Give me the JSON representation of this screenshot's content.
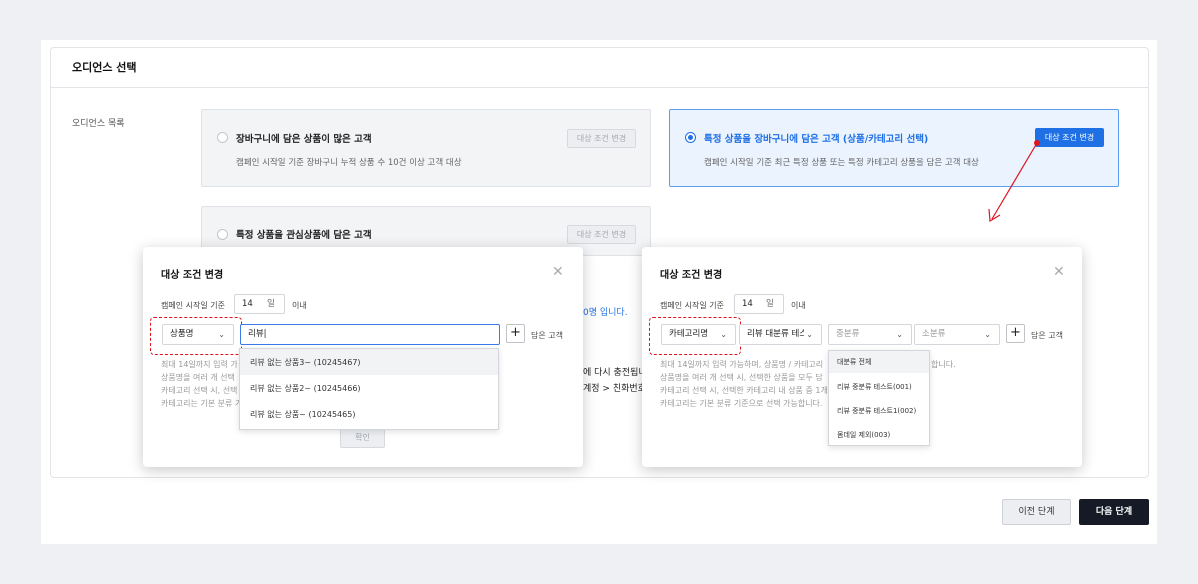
{
  "section": {
    "title": "오디언스 선택",
    "list_label": "오디언스 목록"
  },
  "options": [
    {
      "title": "장바구니에 담은 상품이 많은 고객",
      "desc": "캠페인 시작일 기준 장바구니 누적 상품 수 10건 이상 고객 대상",
      "button": "대상 조건 변경",
      "selected": false
    },
    {
      "title": "특정 상품을 장바구니에 담은 고객 (상품/카테고리 선택)",
      "desc": "캠페인 시작일 기준 최근 특정 상품 또는 특정 카테고리 상품을 담은 고객 대상",
      "button": "대상 조건 변경",
      "selected": true
    },
    {
      "title": "특정 상품을 관심상품에 담은 고객",
      "button": "대상 조건 변경",
      "selected": false
    }
  ],
  "behind_text": {
    "count_suffix": "0명 입니다.",
    "line1": "에 다시 충전됩니",
    "line2": "계정 > 친화번호"
  },
  "modal_left": {
    "title": "대상 조건 변경",
    "start_label": "캠페인 시작일 기준",
    "days": "14",
    "days_unit": "일",
    "within": "이내",
    "type_select": "상품명",
    "search_value": "리뷰",
    "add_label": "담은 고객",
    "dropdown": [
      "리뷰 없는 상품3~ (10245467)",
      "리뷰 없는 상품2~ (10245466)",
      "리뷰 없는 상품~ (10245465)"
    ],
    "notes": [
      "최대 14일까지 입력 가",
      "상품명을 여러 개 선택",
      "카테고리 선택 시, 선택",
      "카테고리는 기본 분류 기"
    ],
    "confirm": "확인"
  },
  "modal_right": {
    "title": "대상 조건 변경",
    "start_label": "캠페인 시작일 기준",
    "days": "14",
    "days_unit": "일",
    "within": "이내",
    "type_select": "카테고리명",
    "large_select": "리뷰 대분류 테스",
    "medium_select": "중분류",
    "small_select": "소분류",
    "add_label": "담은 고객",
    "dropdown": [
      "대분류 전체",
      "리뷰 중분류 테스트(001)",
      "리뷰 중분류 테스트1(002)",
      "몸데일 제외(003)"
    ],
    "notes": [
      "최대 14일까지 입력 가능하며, 상품명 / 카테고리",
      "상품명을 여러 개 선택 시, 선택한 상품을 모두 담",
      "카테고리 선택 시, 선택한 카테고리 내 상품 중 1개",
      "카테고리는 기본 분류 기준으로 선택 가능합니다."
    ],
    "notes_tail": "합니다."
  },
  "footer": {
    "prev": "이전 단계",
    "next": "다음 단계"
  },
  "colors": {
    "accent": "#1f6fe5",
    "annotation": "#e0141e",
    "primary_dark": "#151a26"
  }
}
